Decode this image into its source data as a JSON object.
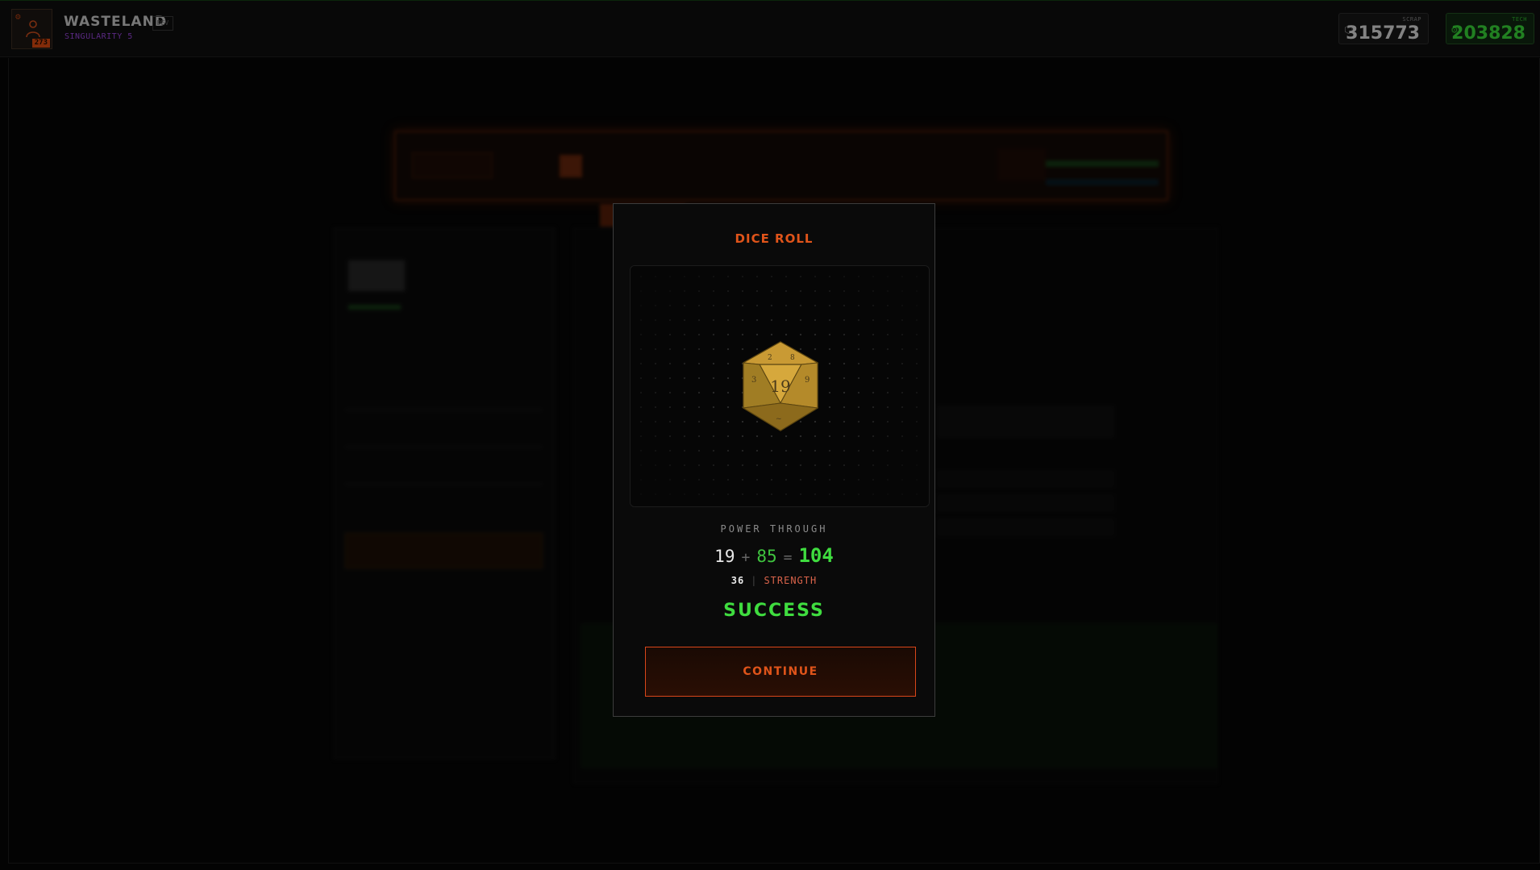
{
  "header": {
    "player_level": "273",
    "game_title": "WASTELAND",
    "subtitle": "SINGULARITY 5",
    "dev_badge": "DEV",
    "resources": [
      {
        "name": "scrap",
        "label": "SCRAP",
        "value": "315773",
        "icon": "hexagon-icon"
      },
      {
        "name": "tech",
        "label": "TECH",
        "value": "203828",
        "icon": "gear-icon"
      }
    ]
  },
  "modal": {
    "title": "DICE ROLL",
    "die": {
      "face_value": "19",
      "type": "d20"
    },
    "action_label": "POWER THROUGH",
    "roll": {
      "base": "19",
      "plus": "+",
      "bonus": "85",
      "equals": "=",
      "total": "104"
    },
    "check": {
      "dc": "36",
      "separator": "|",
      "stat": "STRENGTH"
    },
    "result": "SUCCESS",
    "continue_label": "CONTINUE"
  },
  "colors": {
    "accent_orange": "#e0541a",
    "success_green": "#3fdc3f",
    "tech_green": "#34c534",
    "singularity_purple": "#8a3fc8",
    "die_gold": "#c9a23a"
  }
}
